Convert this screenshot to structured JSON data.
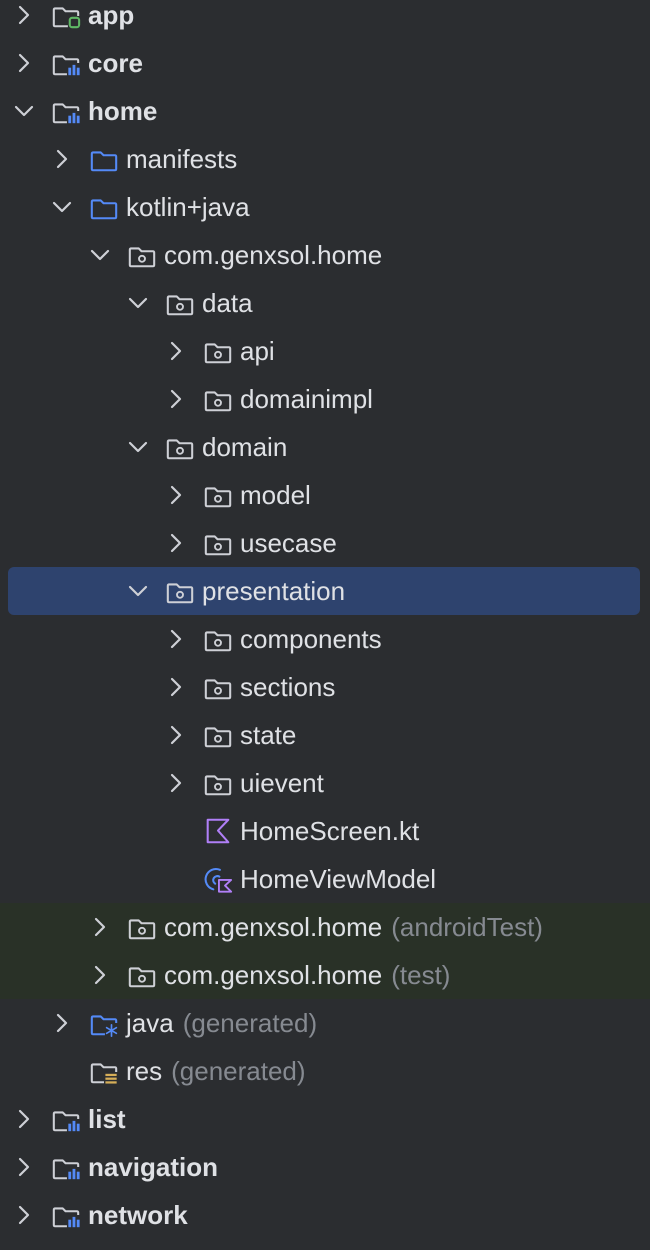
{
  "project_tree": {
    "nodes": [
      {
        "label": "app",
        "suffix": "",
        "depth": 0,
        "expander": "collapsed",
        "icon": "module-android-icon",
        "bold": true
      },
      {
        "label": "core",
        "suffix": "",
        "depth": 0,
        "expander": "collapsed",
        "icon": "module-library-icon",
        "bold": true
      },
      {
        "label": "home",
        "suffix": "",
        "depth": 0,
        "expander": "expanded",
        "icon": "module-library-icon",
        "bold": true
      },
      {
        "label": "manifests",
        "suffix": "",
        "depth": 1,
        "expander": "collapsed",
        "icon": "folder-icon",
        "bold": false
      },
      {
        "label": "kotlin+java",
        "suffix": "",
        "depth": 1,
        "expander": "expanded",
        "icon": "folder-icon",
        "bold": false
      },
      {
        "label": "com.genxsol.home",
        "suffix": "",
        "depth": 2,
        "expander": "expanded",
        "icon": "package-icon",
        "bold": false
      },
      {
        "label": "data",
        "suffix": "",
        "depth": 3,
        "expander": "expanded",
        "icon": "package-icon",
        "bold": false
      },
      {
        "label": "api",
        "suffix": "",
        "depth": 4,
        "expander": "collapsed",
        "icon": "package-icon",
        "bold": false
      },
      {
        "label": "domainimpl",
        "suffix": "",
        "depth": 4,
        "expander": "collapsed",
        "icon": "package-icon",
        "bold": false
      },
      {
        "label": "domain",
        "suffix": "",
        "depth": 3,
        "expander": "expanded",
        "icon": "package-icon",
        "bold": false
      },
      {
        "label": "model",
        "suffix": "",
        "depth": 4,
        "expander": "collapsed",
        "icon": "package-icon",
        "bold": false
      },
      {
        "label": "usecase",
        "suffix": "",
        "depth": 4,
        "expander": "collapsed",
        "icon": "package-icon",
        "bold": false
      },
      {
        "label": "presentation",
        "suffix": "",
        "depth": 3,
        "expander": "expanded",
        "icon": "package-icon",
        "bold": false,
        "selected": true
      },
      {
        "label": "components",
        "suffix": "",
        "depth": 4,
        "expander": "collapsed",
        "icon": "package-icon",
        "bold": false
      },
      {
        "label": "sections",
        "suffix": "",
        "depth": 4,
        "expander": "collapsed",
        "icon": "package-icon",
        "bold": false
      },
      {
        "label": "state",
        "suffix": "",
        "depth": 4,
        "expander": "collapsed",
        "icon": "package-icon",
        "bold": false
      },
      {
        "label": "uievent",
        "suffix": "",
        "depth": 4,
        "expander": "collapsed",
        "icon": "package-icon",
        "bold": false
      },
      {
        "label": "HomeScreen.kt",
        "suffix": "",
        "depth": 4,
        "expander": "none",
        "icon": "kotlin-file-icon",
        "bold": false
      },
      {
        "label": "HomeViewModel",
        "suffix": "",
        "depth": 4,
        "expander": "none",
        "icon": "kotlin-class-icon",
        "bold": false
      },
      {
        "label": "com.genxsol.home",
        "suffix": "(androidTest)",
        "depth": 2,
        "expander": "collapsed",
        "icon": "package-icon",
        "bold": false,
        "test_root": true
      },
      {
        "label": "com.genxsol.home",
        "suffix": "(test)",
        "depth": 2,
        "expander": "collapsed",
        "icon": "package-icon",
        "bold": false,
        "test_root": true
      },
      {
        "label": "java",
        "suffix": "(generated)",
        "depth": 1,
        "expander": "collapsed",
        "icon": "generated-source-folder-icon",
        "bold": false
      },
      {
        "label": "res",
        "suffix": "(generated)",
        "depth": 1,
        "expander": "none",
        "icon": "resource-folder-icon",
        "bold": false
      },
      {
        "label": "list",
        "suffix": "",
        "depth": 0,
        "expander": "collapsed",
        "icon": "module-library-icon",
        "bold": true
      },
      {
        "label": "navigation",
        "suffix": "",
        "depth": 0,
        "expander": "collapsed",
        "icon": "module-library-icon",
        "bold": true
      },
      {
        "label": "network",
        "suffix": "",
        "depth": 0,
        "expander": "collapsed",
        "icon": "module-library-icon",
        "bold": true
      }
    ]
  },
  "colors": {
    "background": "#2b2d30",
    "selection": "#2e436e",
    "test_root_background": "#293127",
    "text": "#dfe1e5",
    "muted_text": "#868a91",
    "folder_blue": "#548af7",
    "module_green": "#5fb865",
    "kotlin_purple": "#b07ff7",
    "resource_yellow": "#d6ae58"
  }
}
